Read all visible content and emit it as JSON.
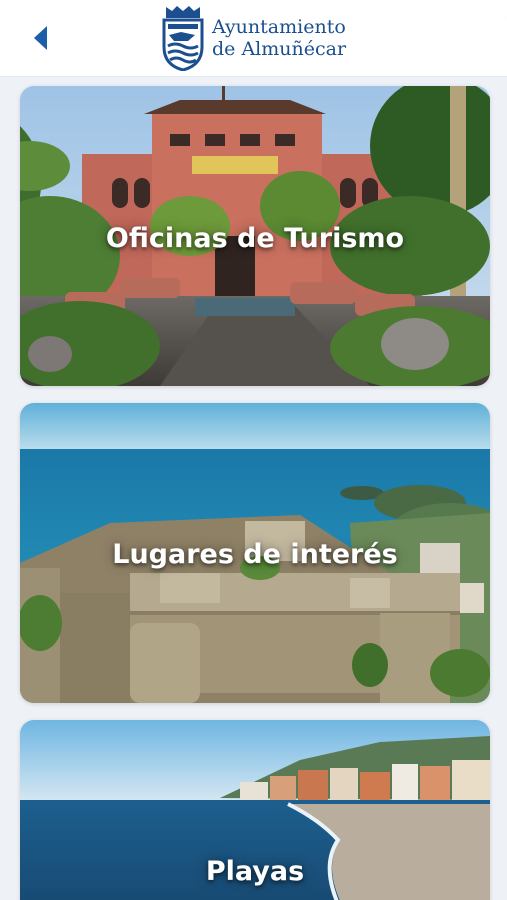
{
  "header": {
    "back_icon": "chevron-left-icon",
    "brand_line1": "Ayuntamiento",
    "brand_line2": "de Almuñécar",
    "crest_icon": "crest-icon",
    "brand_color": "#1c4f8f"
  },
  "cards": [
    {
      "label": "Oficinas de Turismo"
    },
    {
      "label": "Lugares de interés"
    },
    {
      "label": "Playas"
    }
  ]
}
